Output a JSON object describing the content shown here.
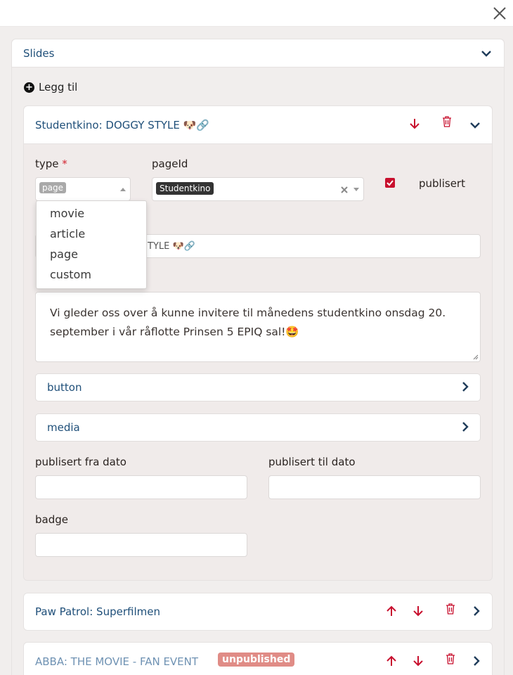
{
  "slides_section": {
    "title": "Slides",
    "add_label": "Legg til"
  },
  "slide1": {
    "title": "Studentkino: DOGGY STYLE 🐶🔗",
    "type_label": "type",
    "required_mark": "*",
    "type_value": "page",
    "pageid_label": "pageId",
    "pageid_value": "Studentkino",
    "publisert_label": "publisert",
    "title_field_value": "TYLE 🐶🔗",
    "text_value": "Vi gleder oss over å kunne invitere til månedens studentkino onsdag 20. september i vår råflotte Prinsen 5 EPIQ sal!🤩",
    "button_label": "button",
    "media_label": "media",
    "pub_from_label": "publisert fra dato",
    "pub_to_label": "publisert til dato",
    "badge_label": "badge",
    "type_options": [
      "movie",
      "article",
      "page",
      "custom"
    ]
  },
  "slide2": {
    "title": "Paw Patrol: Superfilmen"
  },
  "slide3": {
    "title": "ABBA: THE MOVIE - FAN EVENT",
    "badge": "unpublished"
  },
  "colors": {
    "accent_red": "#c8102e",
    "link_blue": "#1f4f79"
  }
}
